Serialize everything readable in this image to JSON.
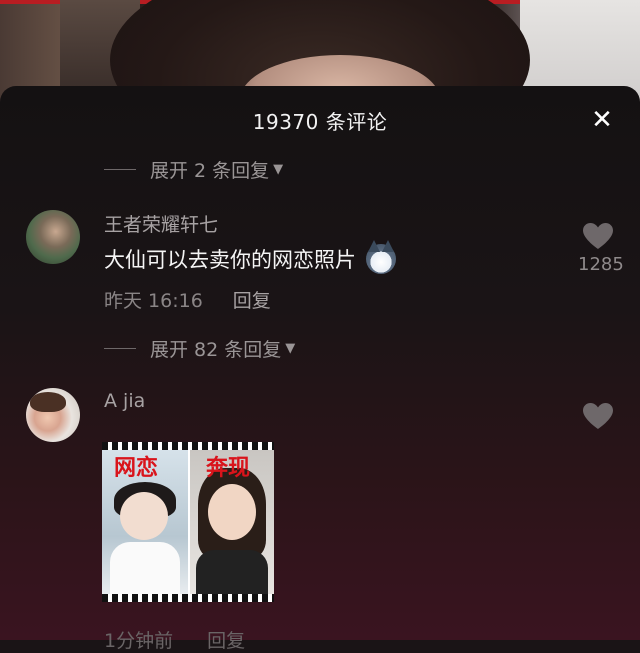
{
  "panel": {
    "title": "19370 条评论",
    "close_label": "✕"
  },
  "threads": [
    {
      "expand_label": "展开 2 条回复",
      "username": "王者荣耀轩七",
      "comment": "大仙可以去卖你的网恋照片",
      "emoji_icon": "husky-emoji-icon",
      "timestamp": "昨天 16:16",
      "reply_label": "回复",
      "likes": "1285"
    },
    {
      "expand_label": "展开 82 条回复",
      "username": "A jia",
      "image": {
        "label_left": "网恋",
        "label_right": "奔现"
      },
      "timestamp": "1分钟前",
      "reply_label": "回复"
    }
  ],
  "colors": {
    "accent_red": "#d9141b",
    "panel_bg": "#1a1416",
    "muted_text": "#a7a2a3"
  }
}
